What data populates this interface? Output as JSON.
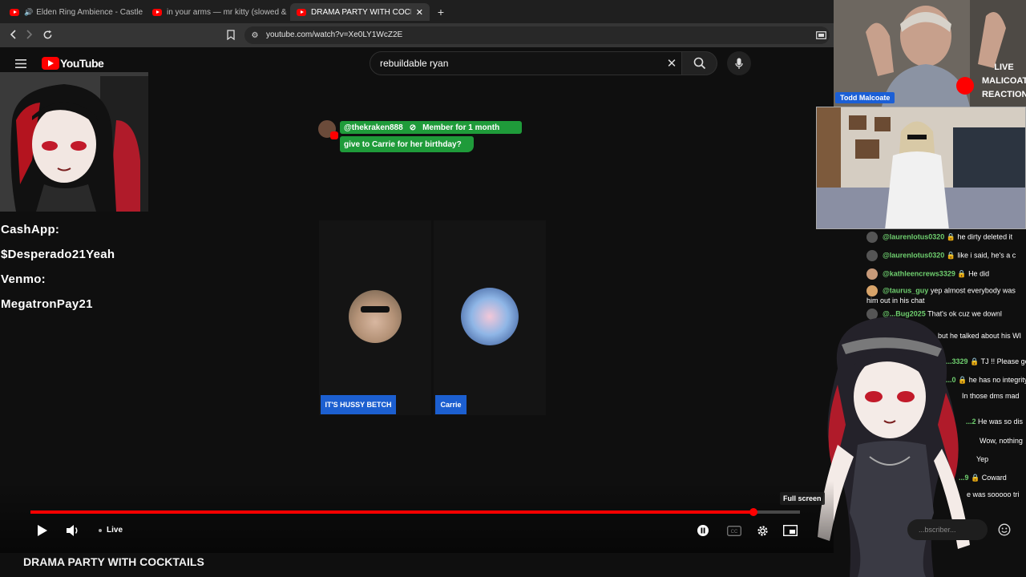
{
  "browser": {
    "tabs": [
      {
        "title": "Elden Ring Ambience - Castle"
      },
      {
        "title": "in your arms — mr kitty (slowed & re"
      },
      {
        "title": "DRAMA PARTY WITH COCKTAILS"
      }
    ],
    "url": "youtube.com/watch?v=Xe0LY1WcZ2E"
  },
  "youtube": {
    "logo": "YouTube",
    "search_value": "rebuildable ryan"
  },
  "overlay": {
    "donation_lines": [
      "CashApp:",
      "$Desperado21Yeah",
      "Venmo:",
      "MegatronPay21"
    ],
    "member_handle": "@thekraken888",
    "member_badge": "Member for 1 month",
    "member_message": "give to Carrie for her birthday?",
    "choices": [
      "IT'S HUSSY BETCH",
      "Carrie"
    ],
    "cam_name": "Todd Malcoate",
    "live_label": [
      "LIVE",
      "MALICOATE",
      "REACTION"
    ]
  },
  "chat": [
    {
      "user": "@laurenlotus0320",
      "msg": "he dirty deleted it"
    },
    {
      "user": "@laurenlotus0320",
      "msg": "like i said, he's a c"
    },
    {
      "user": "@kathleencrews3329",
      "msg": "He did"
    },
    {
      "user": "@taurus_guy",
      "msg": "yep almost everybody was him out in his chat"
    },
    {
      "user": "@...Bug2025",
      "msg": "That's ok cuz we downl"
    },
    {
      "user": "",
      "msg": "but he talked about his WI"
    },
    {
      "user": "...3329",
      "msg": "TJ !! Please ge"
    },
    {
      "user": "...0",
      "msg": "he has no integrity"
    },
    {
      "user": "",
      "msg": "In those dms mad"
    },
    {
      "user": "...2",
      "msg": "He was so dis"
    },
    {
      "user": "",
      "msg": "Wow, nothing"
    },
    {
      "user": "",
      "msg": "Yep"
    },
    {
      "user": "...9",
      "msg": "Coward"
    },
    {
      "user": "",
      "msg": "e was sooooo tri"
    }
  ],
  "player": {
    "live_label": "Live",
    "fullscreen_tooltip": "Full screen",
    "chat_placeholder": "...bscriber...",
    "progress": 0.94,
    "video_title": "DRAMA PARTY WITH COCKTAILS"
  },
  "colors": {
    "accent": "#ff0000",
    "member": "#1f9b3a",
    "choice": "#1c5fd0"
  }
}
